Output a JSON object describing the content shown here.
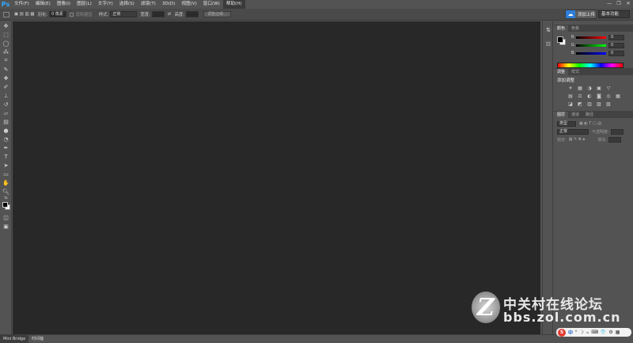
{
  "app": {
    "logo": "Ps"
  },
  "menu": [
    "文件(F)",
    "编辑(E)",
    "图像(I)",
    "图层(L)",
    "文字(Y)",
    "选择(S)",
    "滤镜(T)",
    "3D(D)",
    "视图(V)",
    "窗口(W)",
    "帮助(H)"
  ],
  "window_controls": [
    "—",
    "❐",
    "✕"
  ],
  "options": {
    "feather_label": "羽化:",
    "feather_value": "0 像素",
    "antialias_label": "消除锯齿",
    "style_label": "样式:",
    "style_value": "正常",
    "width_label": "宽度:",
    "height_label": "高度:",
    "refine_edge": "调整边缘..."
  },
  "upload": {
    "label": "添加上传"
  },
  "workspace": {
    "value": "基本功能"
  },
  "status_tabs": [
    "Mini Bridge",
    "时间轴"
  ],
  "color_panel": {
    "tabs": [
      "颜色",
      "色板"
    ],
    "channels": [
      {
        "label": "R",
        "value": "0",
        "track": "#d04040"
      },
      {
        "label": "G",
        "value": "0",
        "track": "#40b040"
      },
      {
        "label": "B",
        "value": "0",
        "track": "#4060d0"
      }
    ]
  },
  "adjust_panel": {
    "tabs": [
      "调整",
      "样式"
    ],
    "title": "添加调整",
    "icons": [
      "☀",
      "▦",
      "◑",
      "▣",
      "▽",
      "",
      "▤",
      "⚖",
      "◐",
      "◙",
      "◎",
      "▦",
      "◪",
      "◩",
      "▥",
      "▨",
      "▧",
      ""
    ]
  },
  "layers_panel": {
    "tabs": [
      "图层",
      "通道",
      "路径"
    ],
    "kind_label": "类型",
    "blend_value": "正常",
    "opacity_label": "不透明度:",
    "lock_label": "锁定:",
    "fill_label": "填充:"
  },
  "watermark": {
    "cn": "中关村在线论坛",
    "url": "bbs.zol.com.cn",
    "letter": "Z"
  },
  "ime": {
    "logo": "S",
    "items": [
      "中",
      "⁰",
      "☽",
      "⸰",
      "⌨",
      "👕",
      "⚙",
      "▦"
    ]
  }
}
